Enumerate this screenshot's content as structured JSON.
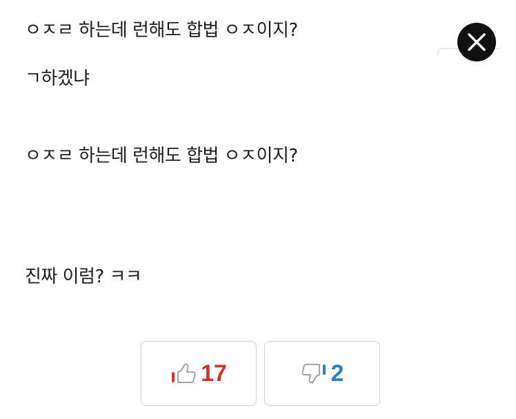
{
  "post": {
    "lines": [
      "ㅇㅈㄹ 하는데 런해도 합법 ㅇㅈ이지?",
      "ㄱ하겠냐",
      "ㅇㅈㄹ 하는데 런해도 합법 ㅇㅈ이지?",
      "진짜 이럼? ㅋㅋ"
    ]
  },
  "close_button": {
    "icon": "close-icon"
  },
  "votes": {
    "up": {
      "count": "17",
      "icon": "thumbs-up-icon",
      "color": "#c0392b"
    },
    "down": {
      "count": "2",
      "icon": "thumbs-down-icon",
      "color": "#2f7fc1"
    }
  }
}
